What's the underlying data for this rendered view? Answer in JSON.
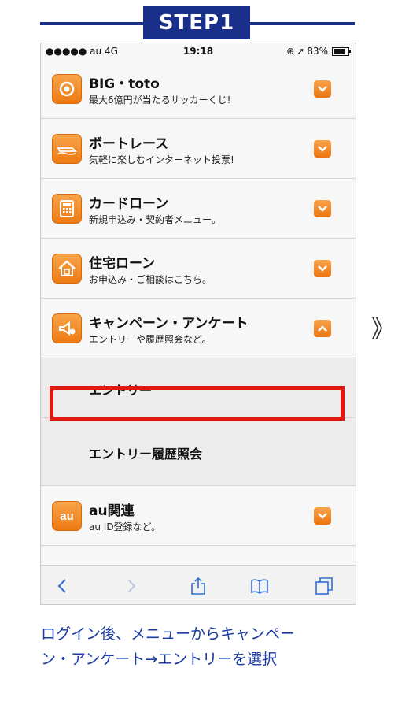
{
  "step": {
    "label": "STEP1"
  },
  "status_bar": {
    "carrier": "●●●●● au 4G",
    "time": "19:18",
    "battery": "83%"
  },
  "menu_items": [
    {
      "title": "BIG・toto",
      "subtitle": "最大6億円が当たるサッカーくじ!",
      "icon": "target-icon",
      "expanded": false
    },
    {
      "title": "ボートレース",
      "subtitle": "気軽に楽しむインターネット投票!",
      "icon": "boat-icon",
      "expanded": false
    },
    {
      "title": "カードローン",
      "subtitle": "新規申込み・契約者メニュー。",
      "icon": "calculator-icon",
      "expanded": false
    },
    {
      "title": "住宅ローン",
      "subtitle": "お申込み・ご相談はこちら。",
      "icon": "house-icon",
      "expanded": false
    },
    {
      "title": "キャンペーン・アンケート",
      "subtitle": "エントリーや履歴照会など。",
      "icon": "campaign-icon",
      "expanded": true
    }
  ],
  "sub_items": [
    {
      "label": "エントリー",
      "highlighted": true
    },
    {
      "label": "エントリー履歴照会",
      "highlighted": false
    }
  ],
  "au_item": {
    "title": "au関連",
    "subtitle": "au ID登録など。",
    "icon_text": "au"
  },
  "next_arrow": "》",
  "caption": {
    "line1": "ログイン後、メニューからキャンペー",
    "line2": "ン・アンケート→エントリーを選択"
  },
  "colors": {
    "accent_blue": "#1a2f8a",
    "caption_blue": "#1a3ba6",
    "icon_orange": "#ee7a12",
    "highlight_red": "#e0180f"
  }
}
